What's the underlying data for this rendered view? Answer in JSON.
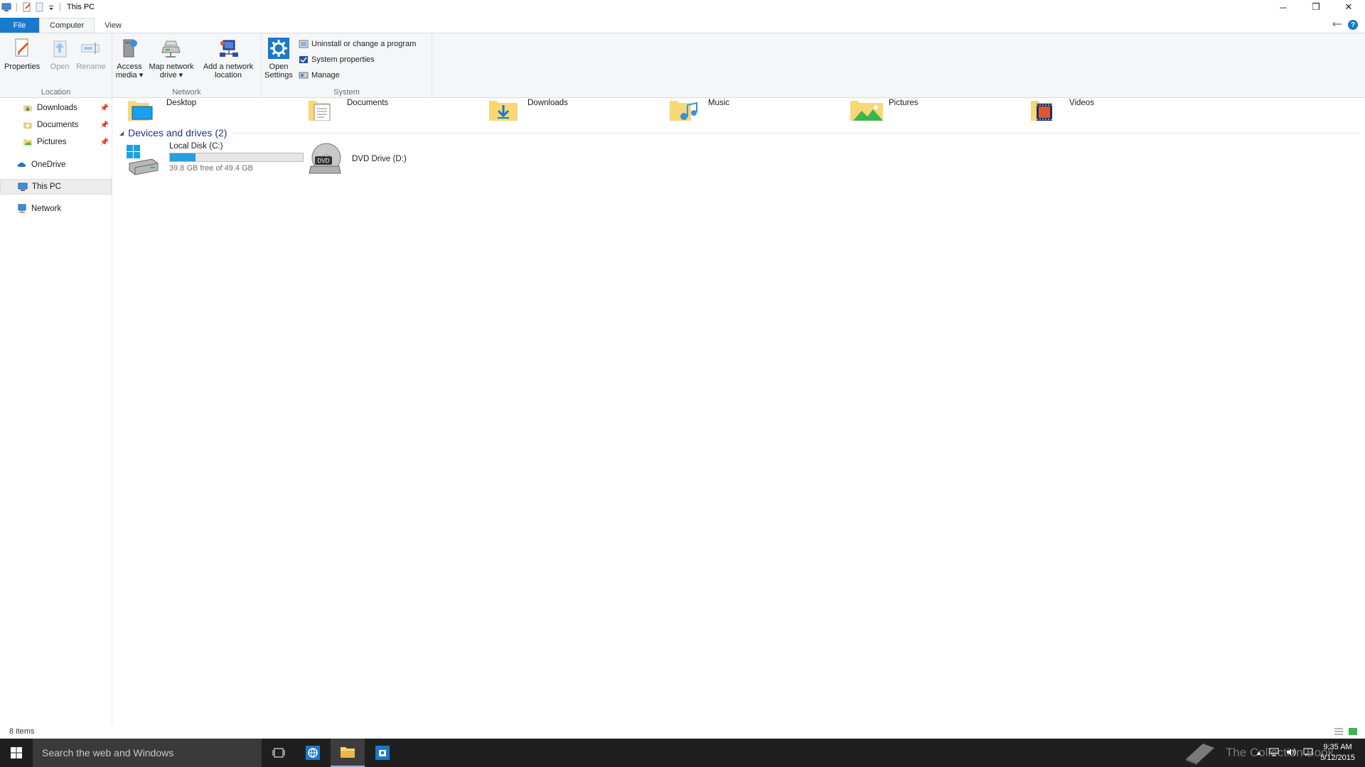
{
  "window": {
    "title": "This PC",
    "controls": {
      "minimize": "─",
      "restore": "❐",
      "close": "✕"
    }
  },
  "tabs": {
    "file": "File",
    "computer": "Computer",
    "view": "View"
  },
  "ribbon": {
    "location": {
      "label": "Location",
      "properties": "Properties",
      "open": "Open",
      "rename": "Rename"
    },
    "network": {
      "label": "Network",
      "access_media_1": "Access",
      "access_media_2": "media ▾",
      "map_drive_1": "Map network",
      "map_drive_2": "drive ▾",
      "add_location_1": "Add a network",
      "add_location_2": "location"
    },
    "system": {
      "label": "System",
      "open_settings_1": "Open",
      "open_settings_2": "Settings",
      "uninstall": "Uninstall or change a program",
      "system_properties": "System properties",
      "manage": "Manage"
    }
  },
  "nav": {
    "downloads": "Downloads",
    "documents": "Documents",
    "pictures": "Pictures",
    "onedrive": "OneDrive",
    "this_pc": "This PC",
    "network": "Network"
  },
  "folders": [
    "Desktop",
    "Documents",
    "Downloads",
    "Music",
    "Pictures",
    "Videos"
  ],
  "devices": {
    "title": "Devices and drives (2)",
    "local_disk": {
      "name": "Local Disk (C:)",
      "free": "39.8 GB free of 49.4 GB",
      "used_fraction": 0.194
    },
    "dvd": {
      "name": "DVD Drive (D:)",
      "badge": "DVD"
    }
  },
  "status": {
    "items": "8 items"
  },
  "taskbar": {
    "search_placeholder": "Search the web and Windows",
    "watermark": "The Collection Book",
    "time": "9:35 AM",
    "date": "5/12/2015"
  },
  "colors": {
    "accent": "#1979ca",
    "progress": "#26a0da",
    "section_title": "#1e3287",
    "taskbar": "#1f1f1f"
  }
}
